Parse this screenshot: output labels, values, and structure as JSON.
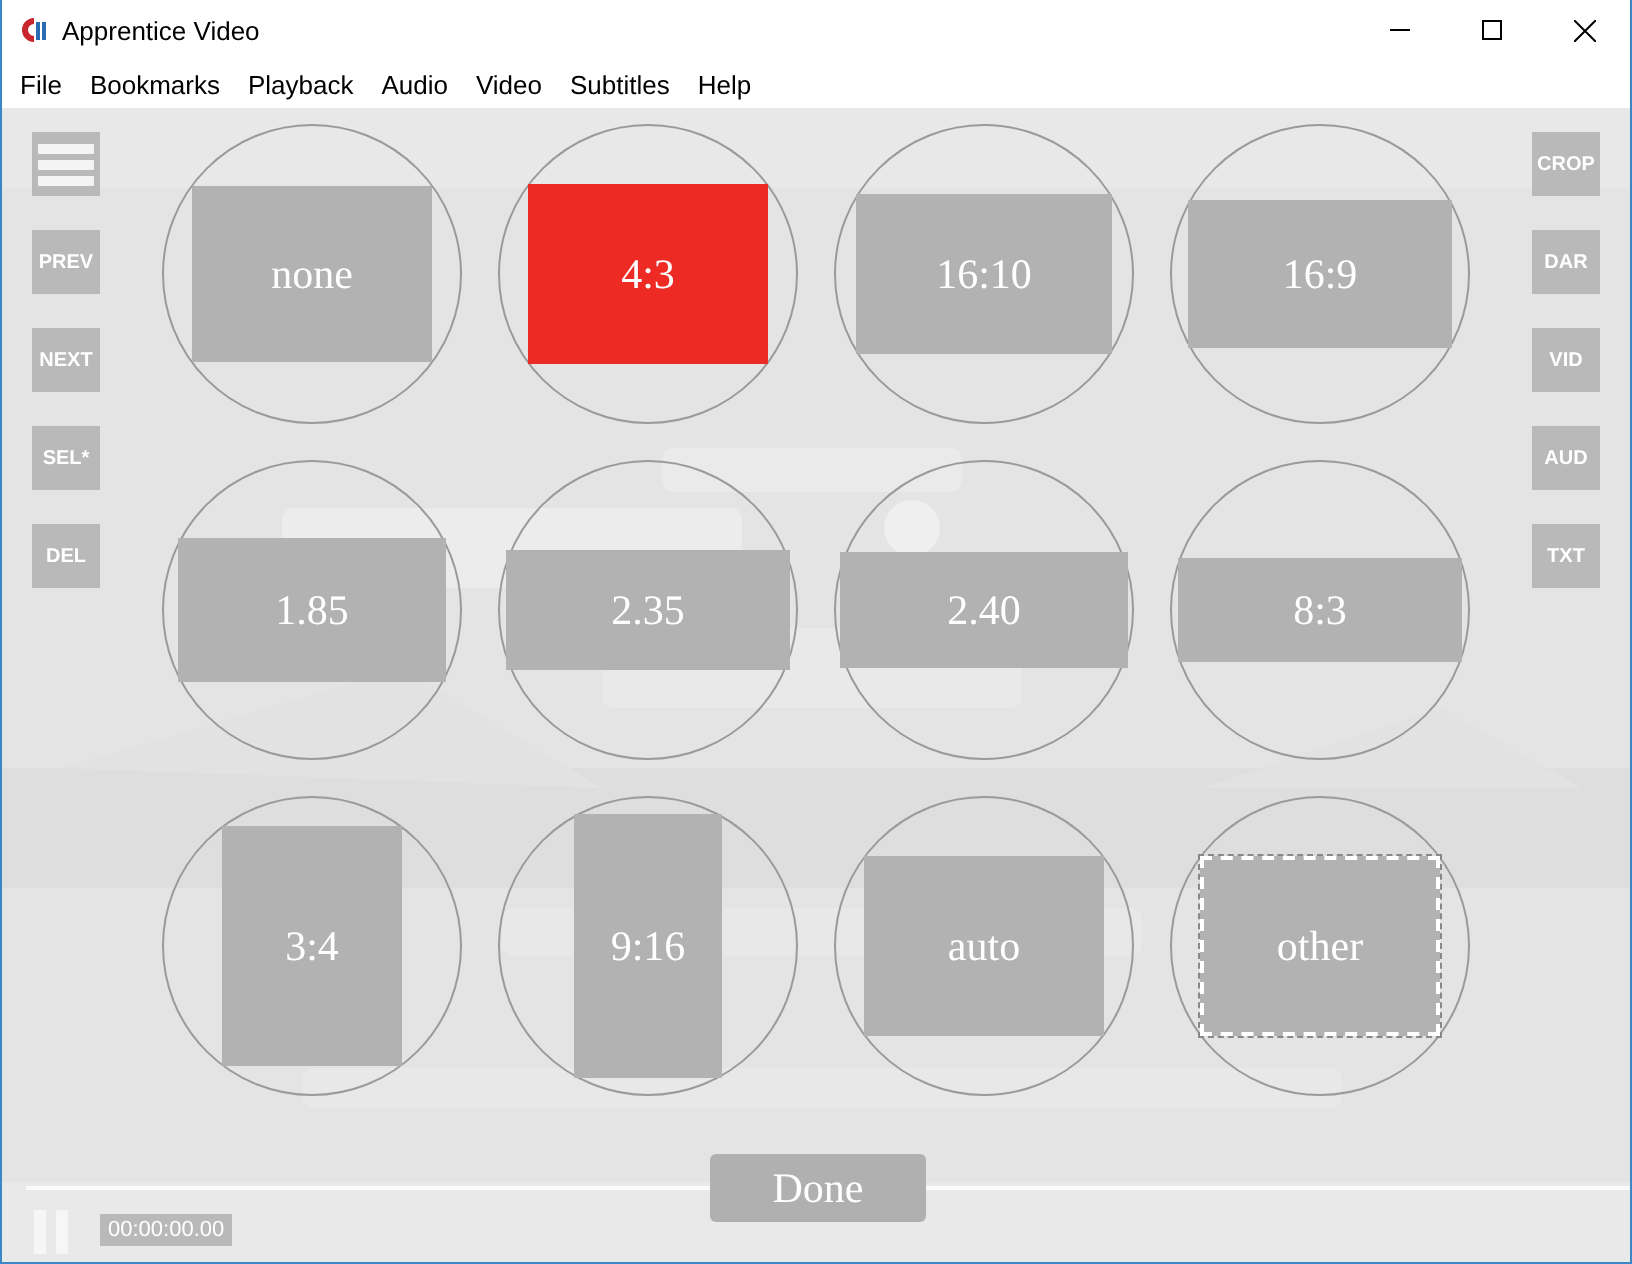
{
  "window": {
    "title": "Apprentice Video"
  },
  "menu": [
    "File",
    "Bookmarks",
    "Playback",
    "Audio",
    "Video",
    "Subtitles",
    "Help"
  ],
  "left_buttons": [
    "PREV",
    "NEXT",
    "SEL*",
    "DEL"
  ],
  "right_buttons": [
    "CROP",
    "DAR",
    "VID",
    "AUD",
    "TXT"
  ],
  "video": {
    "kind": "picture"
  },
  "aspect_options": [
    {
      "label": "none",
      "kind": "ratio",
      "selected": false
    },
    {
      "label": "4:3",
      "kind": "ratio",
      "selected": true
    },
    {
      "label": "16:10",
      "kind": "ratio",
      "selected": false
    },
    {
      "label": "16:9",
      "kind": "ratio",
      "selected": false
    },
    {
      "label": "1.85",
      "kind": "ratio",
      "selected": false
    },
    {
      "label": "2.35",
      "kind": "ratio",
      "selected": false
    },
    {
      "label": "2.40",
      "kind": "ratio",
      "selected": false
    },
    {
      "label": "8:3",
      "kind": "ratio",
      "selected": false
    },
    {
      "label": "3:4",
      "kind": "ratio",
      "selected": false
    },
    {
      "label": "9:16",
      "kind": "ratio",
      "selected": false
    },
    {
      "label": "auto",
      "kind": "ratio",
      "selected": false
    },
    {
      "label": "other",
      "kind": "custom",
      "selected": false
    }
  ],
  "done_button": "Done",
  "player": {
    "time": "00:00:00.00",
    "playing": true
  }
}
